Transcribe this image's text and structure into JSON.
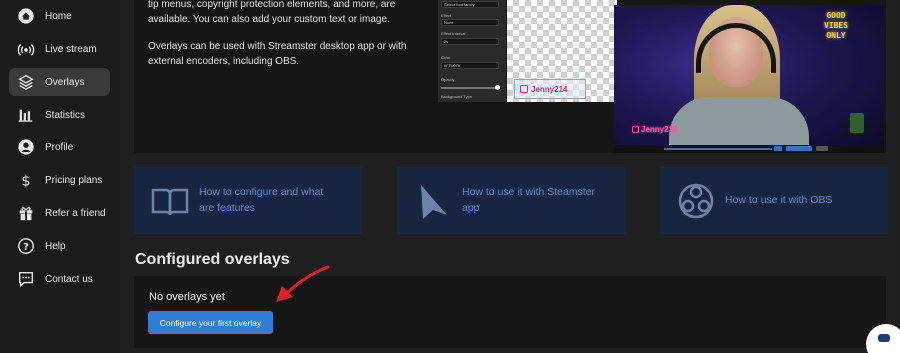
{
  "sidebar": {
    "items": [
      {
        "label": "Home",
        "icon": "home-icon",
        "active": false
      },
      {
        "label": "Live stream",
        "icon": "live-stream-icon",
        "active": false
      },
      {
        "label": "Overlays",
        "icon": "layers-icon",
        "active": true
      },
      {
        "label": "Statistics",
        "icon": "bar-chart-icon",
        "active": false
      },
      {
        "label": "Profile",
        "icon": "user-icon",
        "active": false
      },
      {
        "label": "Pricing plans",
        "icon": "dollar-icon",
        "active": false
      },
      {
        "label": "Refer a friend",
        "icon": "gift-icon",
        "active": false
      },
      {
        "label": "Help",
        "icon": "help-icon",
        "active": false
      },
      {
        "label": "Contact us",
        "icon": "chat-icon",
        "active": false
      }
    ]
  },
  "intro": {
    "line1": "tip menus, copyright protection elements, and more, are",
    "line2": "available. You can also add your custom text or image.",
    "para2_line1": "Overlays can be used with Streamster desktop app or with",
    "para2_line2": "external encoders, including OBS."
  },
  "preview": {
    "editor": {
      "select_font": "Select font family",
      "effect_label": "Effect",
      "effect_value": "None",
      "interval_label": "Effect Interval",
      "interval_value": "2s",
      "color_label": "Color",
      "color_value": "#FF0079",
      "opacity_label": "Opacity",
      "bg_label": "Background Type"
    },
    "tag_text": "Jenny214",
    "photo_tag_text": "Jenny214",
    "neon_text": "GOOD VIBES ONLY"
  },
  "cards": [
    {
      "text_line1": "How to configure and what",
      "text_line2": "are features",
      "icon": "book-icon"
    },
    {
      "text_line1": "How to use it with Steamster",
      "text_line2": "app",
      "icon": "streamster-logo-icon"
    },
    {
      "text_line1": "How to use it with OBS",
      "text_line2": "",
      "icon": "obs-logo-icon"
    }
  ],
  "configured": {
    "title": "Configured overlays",
    "empty_text": "No overlays yet",
    "cta_label": "Configure your first overlay"
  },
  "colors": {
    "accent": "#2e7ed7",
    "card_bg": "#162640",
    "card_text": "#4d8fd8",
    "arrow": "#e02020"
  }
}
